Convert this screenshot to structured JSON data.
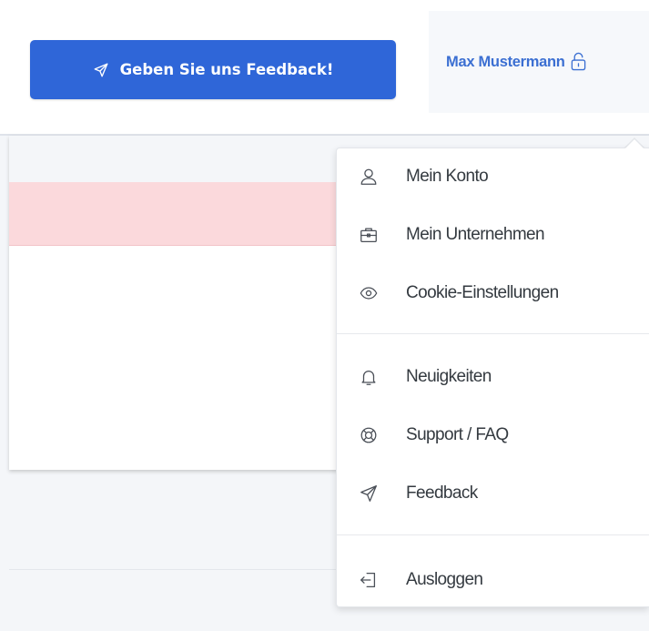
{
  "header": {
    "feedback_button_label": "Geben Sie uns Feedback!",
    "feedback_icon": "paper-plane-icon",
    "user_name": "Max Mustermann",
    "user_icon": "unlock-icon"
  },
  "menu": {
    "groups": [
      {
        "items": [
          {
            "label": "Mein Konto",
            "icon": "user-icon"
          },
          {
            "label": "Mein Unternehmen",
            "icon": "briefcase-icon"
          },
          {
            "label": "Cookie-Einstellungen",
            "icon": "eye-icon"
          }
        ]
      },
      {
        "items": [
          {
            "label": "Neuigkeiten",
            "icon": "bell-icon"
          },
          {
            "label": "Support / FAQ",
            "icon": "lifebuoy-icon"
          },
          {
            "label": "Feedback",
            "icon": "paper-plane-icon"
          }
        ]
      },
      {
        "items": [
          {
            "label": "Ausloggen",
            "icon": "logout-icon"
          }
        ]
      }
    ]
  },
  "colors": {
    "primary_button": "#2f66d8",
    "user_name_text": "#3b6fd2",
    "alert_row": "#fbd9dc",
    "page_background": "#f4f6f9"
  }
}
